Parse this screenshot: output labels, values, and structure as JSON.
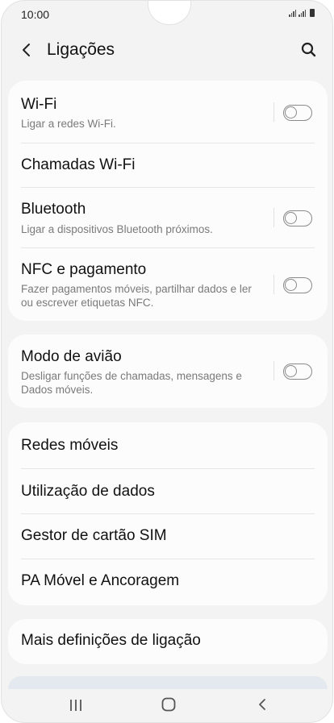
{
  "status_bar": {
    "time": "10:00"
  },
  "header": {
    "title": "Ligações"
  },
  "section_main": {
    "wifi": {
      "title": "Wi-Fi",
      "subtitle": "Ligar a redes Wi-Fi."
    },
    "wifi_calling": {
      "title": "Chamadas Wi-Fi"
    },
    "bluetooth": {
      "title": "Bluetooth",
      "subtitle": "Ligar a dispositivos Bluetooth próximos."
    },
    "nfc": {
      "title": "NFC e pagamento",
      "subtitle": "Fazer pagamentos móveis, partilhar dados e ler ou escrever etiquetas NFC."
    }
  },
  "section_airplane": {
    "airplane": {
      "title": "Modo de avião",
      "subtitle": "Desligar funções de chamadas, mensagens e Dados móveis."
    }
  },
  "section_network": {
    "items": [
      "Redes móveis",
      "Utilização de dados",
      "Gestor de cartão SIM",
      "PA Móvel e Ancoragem"
    ]
  },
  "section_more": {
    "title": "Mais definições de ligação"
  },
  "toggles": {
    "wifi": false,
    "bluetooth": false,
    "nfc": false,
    "airplane": false
  },
  "colors": {
    "background": "#f3f3f3",
    "card": "#fcfcfc",
    "text": "#111111",
    "subtext": "#7a7a7a"
  }
}
